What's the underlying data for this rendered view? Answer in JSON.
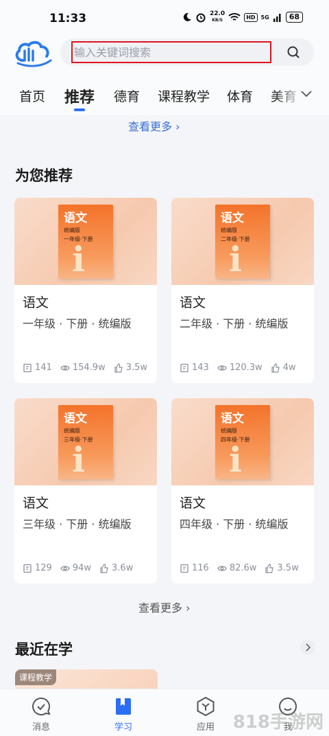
{
  "status_bar": {
    "time": "11:33",
    "speed_value": "22.0",
    "speed_unit": "KB/S",
    "hd": "HD",
    "network": "5G",
    "battery": "68"
  },
  "header": {
    "search_placeholder": "输入关键词搜索"
  },
  "tabs": [
    {
      "label": "首页",
      "active": false
    },
    {
      "label": "推荐",
      "active": true
    },
    {
      "label": "德育",
      "active": false
    },
    {
      "label": "课程教学",
      "active": false
    },
    {
      "label": "体育",
      "active": false
    },
    {
      "label": "美育",
      "active": false
    }
  ],
  "see_more_top": "查看更多 ›",
  "recommend": {
    "title": "为您推荐",
    "cards": [
      {
        "book_title": "语文",
        "book_edition": "统编版",
        "book_grade": "一年级·下册",
        "name": "语文",
        "desc": "一年级 · 下册 · 统编版",
        "lessons": "141",
        "views": "154.9w",
        "likes": "3.5w"
      },
      {
        "book_title": "语文",
        "book_edition": "统编版",
        "book_grade": "二年级·下册",
        "name": "语文",
        "desc": "二年级 · 下册 · 统编版",
        "lessons": "143",
        "views": "120.3w",
        "likes": "4w"
      },
      {
        "book_title": "语文",
        "book_edition": "统编版",
        "book_grade": "三年级·下册",
        "name": "语文",
        "desc": "三年级 · 下册 · 统编版",
        "lessons": "129",
        "views": "94w",
        "likes": "3.6w"
      },
      {
        "book_title": "语文",
        "book_edition": "统编版",
        "book_grade": "四年级·下册",
        "name": "语文",
        "desc": "四年级 · 下册 · 统编版",
        "lessons": "116",
        "views": "82.6w",
        "likes": "3.5w"
      }
    ],
    "see_more": "查看更多 ›"
  },
  "recent": {
    "title": "最近在学",
    "tag": "课程教学"
  },
  "bottom_nav": [
    {
      "label": "消息",
      "icon": "message-icon",
      "active": false
    },
    {
      "label": "学习",
      "icon": "book-icon",
      "active": true
    },
    {
      "label": "应用",
      "icon": "apps-icon",
      "active": false
    },
    {
      "label": "我",
      "icon": "profile-icon",
      "active": false
    }
  ],
  "watermark": "818手游网",
  "colors": {
    "accent": "#2b6ef5",
    "highlight_border": "#e0141e",
    "book_orange": "#f4732a"
  }
}
